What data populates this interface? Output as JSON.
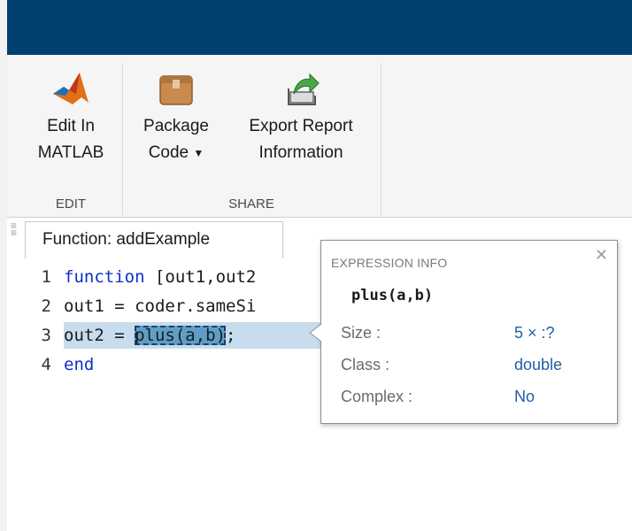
{
  "ribbon": {
    "edit_group": {
      "label": "EDIT",
      "edit_in_matlab": {
        "line1": "Edit In",
        "line2": "MATLAB",
        "icon": "matlab-logo-icon"
      }
    },
    "share_group": {
      "label": "SHARE",
      "package_code": {
        "line1": "Package",
        "line2": "Code",
        "caret": "▼",
        "icon": "package-box-icon"
      },
      "export_report": {
        "line1": "Export Report",
        "line2": "Information",
        "icon": "export-report-icon"
      }
    }
  },
  "editor": {
    "tab_label": "Function: addExample",
    "lines": [
      {
        "num": "1",
        "keyword": "function",
        "rest": " [out1,out2"
      },
      {
        "num": "2",
        "text": "out1 = coder.sameSi"
      },
      {
        "num": "3",
        "pre": "out2 = ",
        "expr": "plus(a,b)",
        "post": ";"
      },
      {
        "num": "4",
        "keyword": "end"
      }
    ]
  },
  "expression_info": {
    "header": "EXPRESSION INFO",
    "close_icon": "close-icon",
    "expression": "plus(a,b)",
    "rows": [
      {
        "key": "Size :",
        "value": "5 × :?"
      },
      {
        "key": "Class :",
        "value": "double"
      },
      {
        "key": "Complex :",
        "value": "No"
      }
    ]
  },
  "colors": {
    "title_bar": "#00406f",
    "keyword": "#0b2fcb",
    "value": "#1f5ea8",
    "line_highlight": "#c7dced"
  }
}
